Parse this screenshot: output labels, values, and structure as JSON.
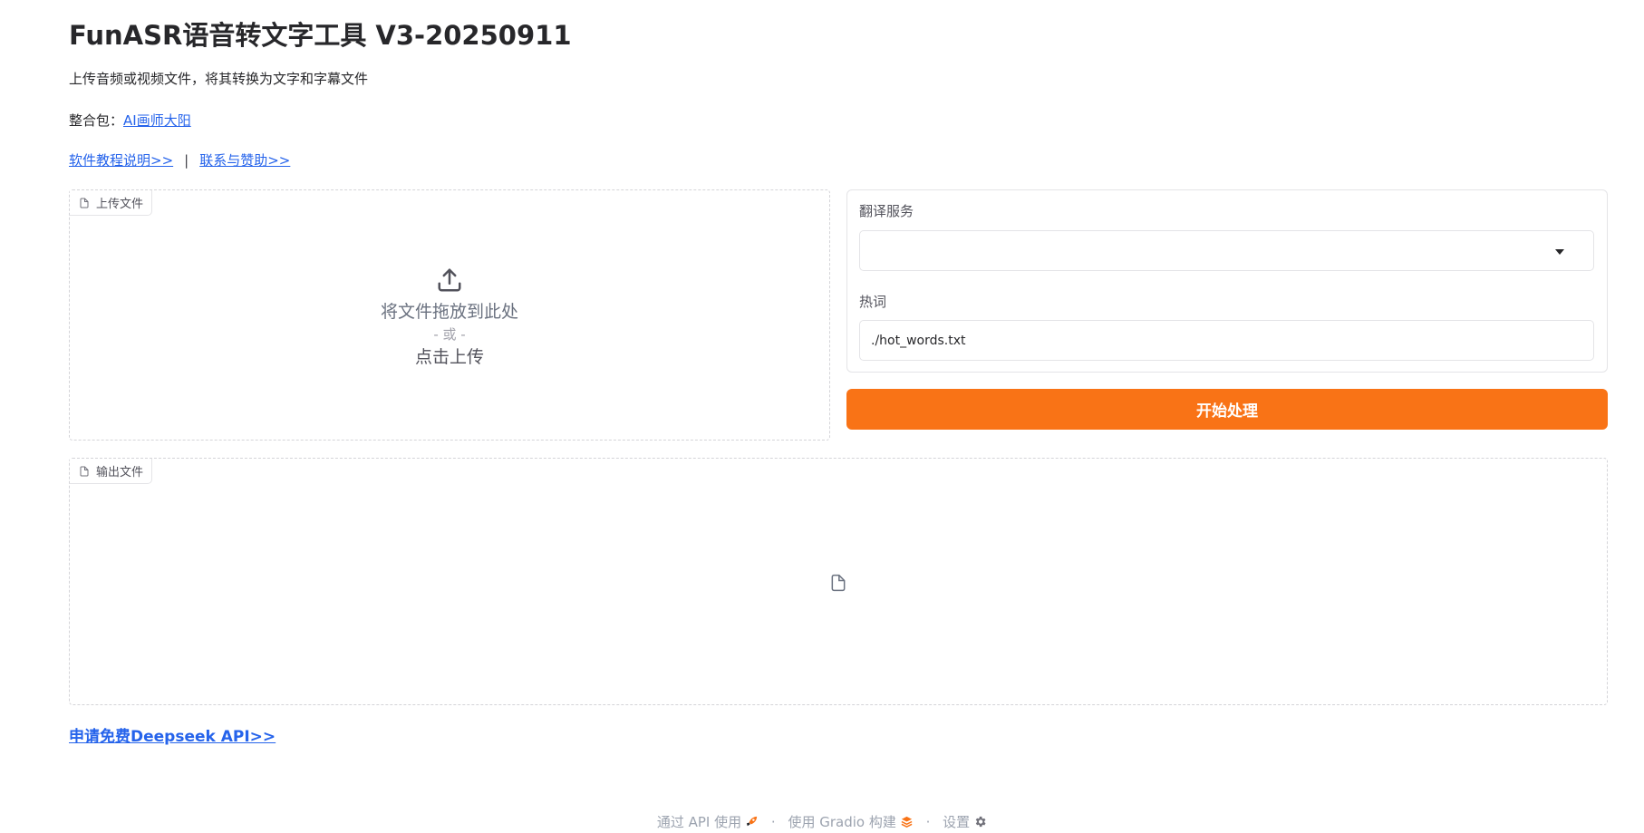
{
  "header": {
    "title": "FunASR语音转文字工具 V3-20250911",
    "subtitle": "上传音频或视频文件，将其转换为文字和字幕文件",
    "bundle_prefix": "整合包：",
    "bundle_link": "AI画师大阳",
    "tutorial_link": "软件教程说明>>",
    "separator": "|",
    "contact_link": "联系与赞助>>"
  },
  "upload": {
    "label": "上传文件",
    "drop_text": "将文件拖放到此处",
    "or_text": "- 或 -",
    "click_text": "点击上传"
  },
  "form": {
    "translation_label": "翻译服务",
    "translation_value": "",
    "hotwords_label": "热词",
    "hotwords_value": "./hot_words.txt"
  },
  "actions": {
    "start_label": "开始处理"
  },
  "output": {
    "label": "输出文件"
  },
  "deepseek_link": "申请免费Deepseek API>>",
  "footer": {
    "api_label": "通过 API 使用",
    "gradio_label": "使用 Gradio 构建",
    "settings_label": "设置",
    "dot": "·"
  },
  "colors": {
    "accent": "#f97316",
    "link": "#2563eb"
  },
  "icons": [
    "file-icon",
    "upload-icon",
    "chevron-down-icon",
    "rocket-icon",
    "gradio-logo-icon",
    "gear-icon"
  ]
}
